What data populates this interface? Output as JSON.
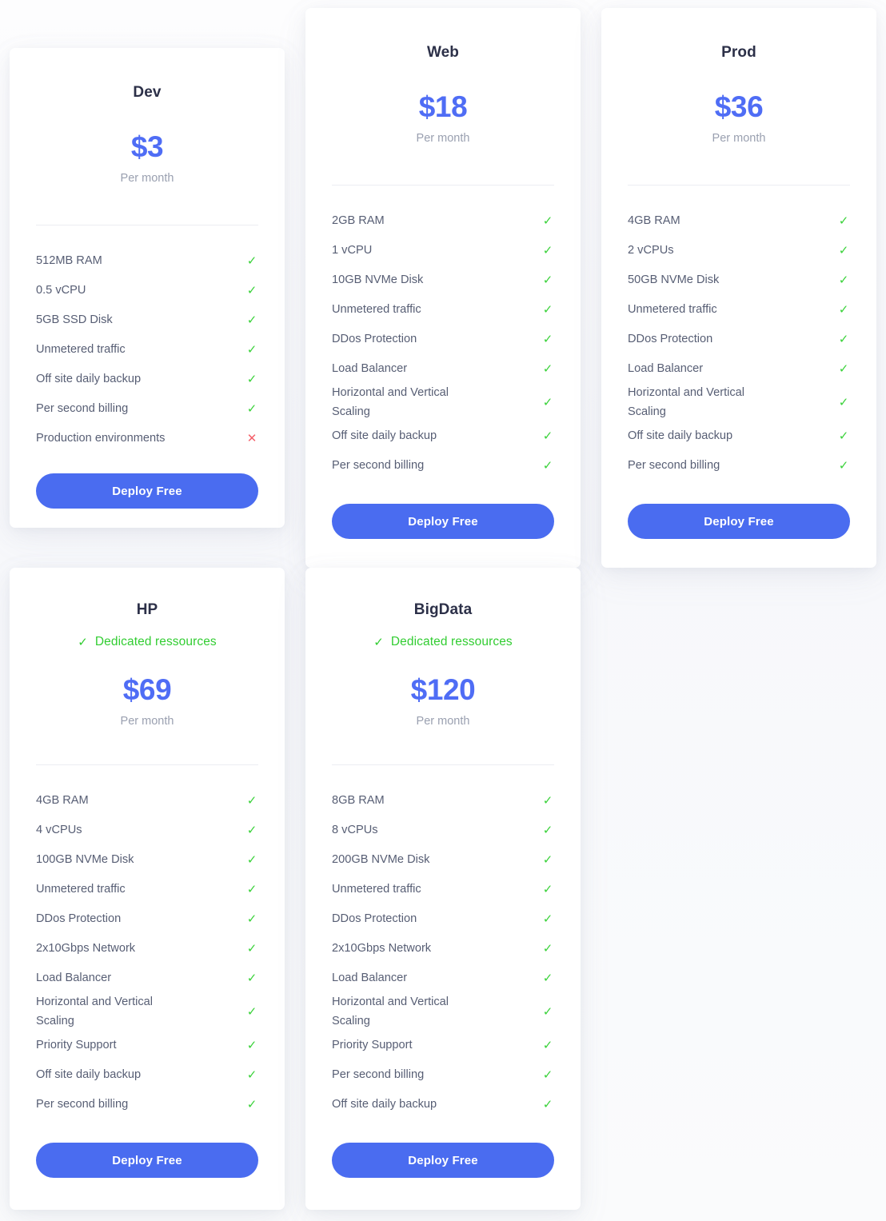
{
  "page": {
    "background_color": "#fbfbfd",
    "accent_color": "#4f6df5",
    "check_color": "#3ad23a",
    "cross_color": "#f4606a"
  },
  "labels": {
    "per_month": "Per month",
    "deploy": "Deploy Free",
    "dedicated": "Dedicated ressources",
    "check_icon": "check-icon",
    "cross_icon": "cross-icon"
  },
  "plans": [
    {
      "id": "dev",
      "name": "Dev",
      "price": "$3",
      "period": "Per month",
      "dedicated": null,
      "cta": "Deploy Free",
      "features": [
        {
          "label": "512MB RAM",
          "included": true
        },
        {
          "label": "0.5 vCPU",
          "included": true
        },
        {
          "label": "5GB SSD Disk",
          "included": true
        },
        {
          "label": "Unmetered traffic",
          "included": true
        },
        {
          "label": "Off site daily backup",
          "included": true
        },
        {
          "label": "Per second billing",
          "included": true
        },
        {
          "label": "Production environments",
          "included": false
        }
      ]
    },
    {
      "id": "web",
      "name": "Web",
      "price": "$18",
      "period": "Per month",
      "dedicated": null,
      "cta": "Deploy Free",
      "features": [
        {
          "label": "2GB RAM",
          "included": true
        },
        {
          "label": "1 vCPU",
          "included": true
        },
        {
          "label": "10GB NVMe Disk",
          "included": true
        },
        {
          "label": "Unmetered traffic",
          "included": true
        },
        {
          "label": "DDos Protection",
          "included": true
        },
        {
          "label": "Load Balancer",
          "included": true
        },
        {
          "label": "Horizontal and Vertical Scaling",
          "included": true
        },
        {
          "label": "Off site daily backup",
          "included": true
        },
        {
          "label": "Per second billing",
          "included": true
        }
      ]
    },
    {
      "id": "prod",
      "name": "Prod",
      "price": "$36",
      "period": "Per month",
      "dedicated": null,
      "cta": "Deploy Free",
      "features": [
        {
          "label": "4GB RAM",
          "included": true
        },
        {
          "label": "2 vCPUs",
          "included": true
        },
        {
          "label": "50GB NVMe Disk",
          "included": true
        },
        {
          "label": "Unmetered traffic",
          "included": true
        },
        {
          "label": "DDos Protection",
          "included": true
        },
        {
          "label": "Load Balancer",
          "included": true
        },
        {
          "label": "Horizontal and Vertical Scaling",
          "included": true
        },
        {
          "label": "Off site daily backup",
          "included": true
        },
        {
          "label": "Per second billing",
          "included": true
        }
      ]
    },
    {
      "id": "hp",
      "name": "HP",
      "price": "$69",
      "period": "Per month",
      "dedicated": "Dedicated ressources",
      "cta": "Deploy Free",
      "features": [
        {
          "label": "4GB RAM",
          "included": true
        },
        {
          "label": "4 vCPUs",
          "included": true
        },
        {
          "label": "100GB NVMe Disk",
          "included": true
        },
        {
          "label": "Unmetered traffic",
          "included": true
        },
        {
          "label": "DDos Protection",
          "included": true
        },
        {
          "label": "2x10Gbps Network",
          "included": true
        },
        {
          "label": "Load Balancer",
          "included": true
        },
        {
          "label": "Horizontal and Vertical Scaling",
          "included": true
        },
        {
          "label": "Priority Support",
          "included": true
        },
        {
          "label": "Off site daily backup",
          "included": true
        },
        {
          "label": "Per second billing",
          "included": true
        }
      ]
    },
    {
      "id": "bigdata",
      "name": "BigData",
      "price": "$120",
      "period": "Per month",
      "dedicated": "Dedicated ressources",
      "cta": "Deploy Free",
      "features": [
        {
          "label": "8GB RAM",
          "included": true
        },
        {
          "label": "8 vCPUs",
          "included": true
        },
        {
          "label": "200GB NVMe Disk",
          "included": true
        },
        {
          "label": "Unmetered traffic",
          "included": true
        },
        {
          "label": "DDos Protection",
          "included": true
        },
        {
          "label": "2x10Gbps Network",
          "included": true
        },
        {
          "label": "Load Balancer",
          "included": true
        },
        {
          "label": "Horizontal and Vertical Scaling",
          "included": true
        },
        {
          "label": "Priority Support",
          "included": true
        },
        {
          "label": "Per second billing",
          "included": true
        },
        {
          "label": "Off site daily backup",
          "included": true
        }
      ]
    }
  ]
}
